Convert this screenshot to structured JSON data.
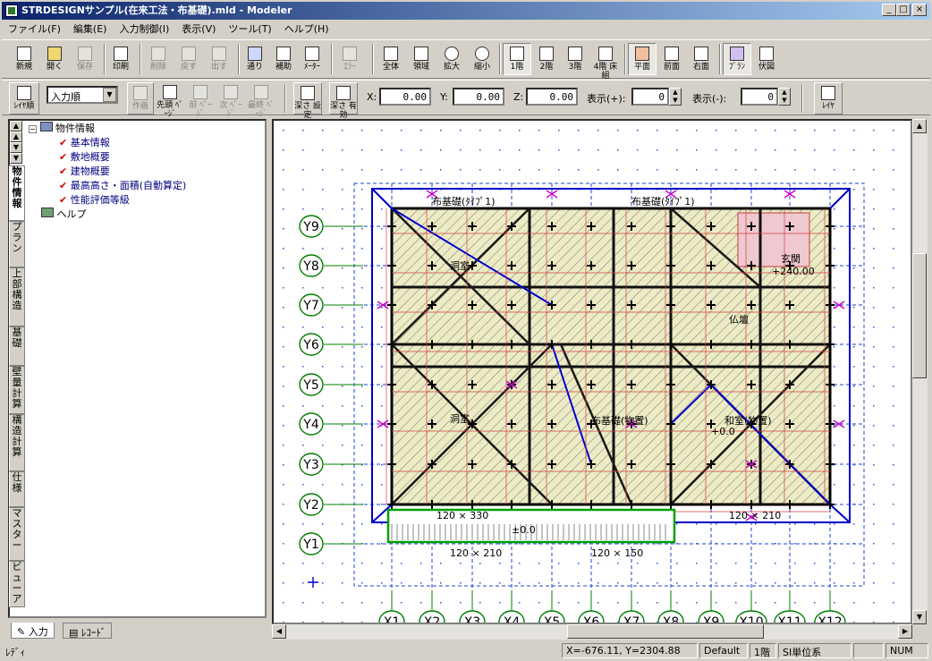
{
  "window": {
    "title": "STRDESIGNサンプル(在来工法・布基礎).mld - Modeler",
    "btn_min": "_",
    "btn_max": "□",
    "btn_close": "×"
  },
  "menu": [
    "ファイル(F)",
    "編集(E)",
    "入力制御(I)",
    "表示(V)",
    "ツール(T)",
    "ヘルプ(H)"
  ],
  "toolbar1": {
    "new": "新規",
    "open": "開く",
    "save": "保存",
    "print": "印刷",
    "delete": "削除",
    "undo": "戻す",
    "redo": "出す",
    "grid": "通り",
    "aux": "補助",
    "meter": "ﾒｰﾀｰ",
    "error": "ｴﾗｰ",
    "whole": "全体",
    "region": "領域",
    "zoomin": "拡大",
    "zoomout": "縮小",
    "f1": "1階",
    "f2": "2階",
    "f3": "3階",
    "roof": "4階 床組",
    "plan": "平面",
    "front": "前面",
    "right": "右面",
    "plan2": "ﾌﾟﾗﾝ",
    "fuku": "伏図"
  },
  "toolbar2": {
    "layer_order": "ﾚｲﾔ順",
    "sort_select": "入力順",
    "draw": "作画",
    "first_page": "先頭 ﾍﾟｰｼﾞ",
    "prev_page": "前 ﾍﾟｰｼﾞ",
    "next_page": "次 ﾍﾟｰｼﾞ",
    "last_page": "最終 ﾍﾟｰｼﾞ",
    "depth_set": "深さ 設定",
    "depth_valid": "深さ 有効",
    "x_label": "X:",
    "x_value": "0.00",
    "y_label": "Y:",
    "y_value": "0.00",
    "z_label": "Z:",
    "z_value": "0.00",
    "disp_plus_label": "表示(+):",
    "disp_plus": "0",
    "disp_minus_label": "表示(-):",
    "disp_minus": "0",
    "layer": "ﾚｲﾔ"
  },
  "side_tabs": [
    "物件情報",
    "プラン",
    "上部構造",
    "基礎",
    "壁量計算",
    "構造計算",
    "仕様",
    "マスター",
    "ビューア"
  ],
  "tree": {
    "root": "物件情報",
    "items": [
      "基本情報",
      "敷地概要",
      "建物概要",
      "最高高さ・面積(自動算定)",
      "性能評価等級"
    ],
    "help": "ヘルプ"
  },
  "bottom_tabs": {
    "input": "入力",
    "record": "ﾚｺｰﾄﾞ"
  },
  "grid": {
    "y_axes": [
      "Y9",
      "Y8",
      "Y7",
      "Y6",
      "Y5",
      "Y4",
      "Y3",
      "Y2",
      "Y1"
    ],
    "x_axes": [
      "X1",
      "X2",
      "X3",
      "X4",
      "X5",
      "X6",
      "X7",
      "X8",
      "X9",
      "X10",
      "X11",
      "X12"
    ]
  },
  "plan_labels": {
    "room_nw": "洞室",
    "room_ne": "玄関",
    "room_w": "洞室",
    "room_mid": "布基礎(物置)",
    "room_e": "和室(物置)",
    "butsudan": "仏壇",
    "e_floor": "+0.0",
    "ne_level": "+240.00",
    "dim1": "120 × 330",
    "dim2": "120 × 210",
    "dim3": "120 × 150",
    "dim4": "120 × 210",
    "porch": "±0.0",
    "kiso_top": "布基礎(ﾀｲﾌﾟ1)",
    "kiso_top2": "布基礎(ﾀｲﾌﾟ1)"
  },
  "status": {
    "left": "ﾚﾃﾞｨ",
    "coord": "X=-676.11, Y=2304.88",
    "mode": "Default",
    "floor": "1階",
    "unit": "SI単位系",
    "num": "NUM"
  },
  "colors": {
    "title_start": "#0a246a",
    "title_end": "#a6caf0",
    "face": "#d4d0c8",
    "wall": "#1a1a1a",
    "grid_blue": "#0000cc",
    "axis_green": "#008000",
    "hatch": "#e8e4b0",
    "magenta": "#cc00cc",
    "red": "#d04040"
  }
}
